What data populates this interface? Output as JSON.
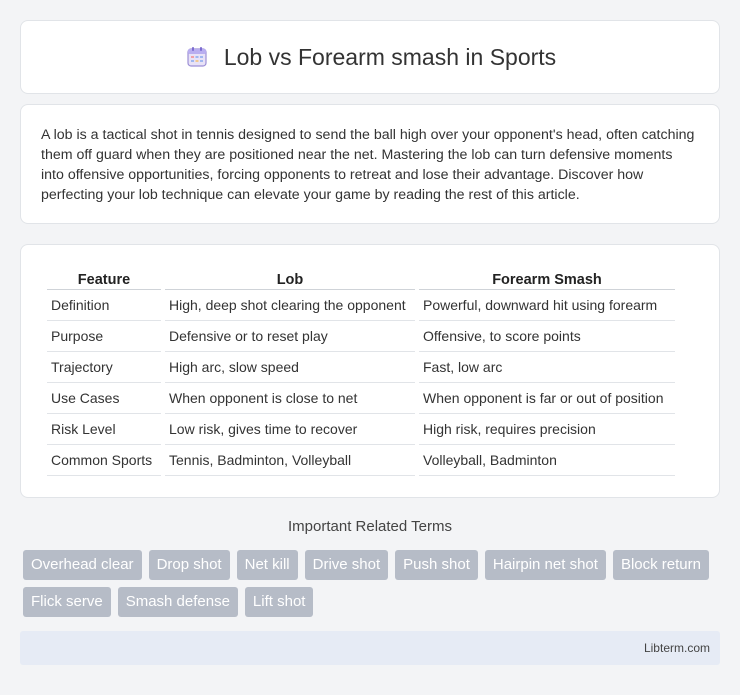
{
  "header": {
    "title": "Lob vs Forearm smash in Sports",
    "icon": "calendar-icon"
  },
  "intro": {
    "text": "A lob is a tactical shot in tennis designed to send the ball high over your opponent's head, often catching them off guard when they are positioned near the net. Mastering the lob can turn defensive moments into offensive opportunities, forcing opponents to retreat and lose their advantage. Discover how perfecting your lob technique can elevate your game by reading the rest of this article."
  },
  "table": {
    "headers": [
      "Feature",
      "Lob",
      "Forearm Smash"
    ],
    "rows": [
      [
        "Definition",
        "High, deep shot clearing the opponent",
        "Powerful, downward hit using forearm"
      ],
      [
        "Purpose",
        "Defensive or to reset play",
        "Offensive, to score points"
      ],
      [
        "Trajectory",
        "High arc, slow speed",
        "Fast, low arc"
      ],
      [
        "Use Cases",
        "When opponent is close to net",
        "When opponent is far or out of position"
      ],
      [
        "Risk Level",
        "Low risk, gives time to recover",
        "High risk, requires precision"
      ],
      [
        "Common Sports",
        "Tennis, Badminton, Volleyball",
        "Volleyball, Badminton"
      ]
    ]
  },
  "related": {
    "title": "Important Related Terms",
    "terms": [
      "Overhead clear",
      "Drop shot",
      "Net kill",
      "Drive shot",
      "Push shot",
      "Hairpin net shot",
      "Block return",
      "Flick serve",
      "Smash defense",
      "Lift shot"
    ]
  },
  "footer": {
    "link": "Libterm.com"
  },
  "colors": {
    "background": "#f3f4f6",
    "tag": "#b6bcc7",
    "footer": "#e6ebf5"
  }
}
